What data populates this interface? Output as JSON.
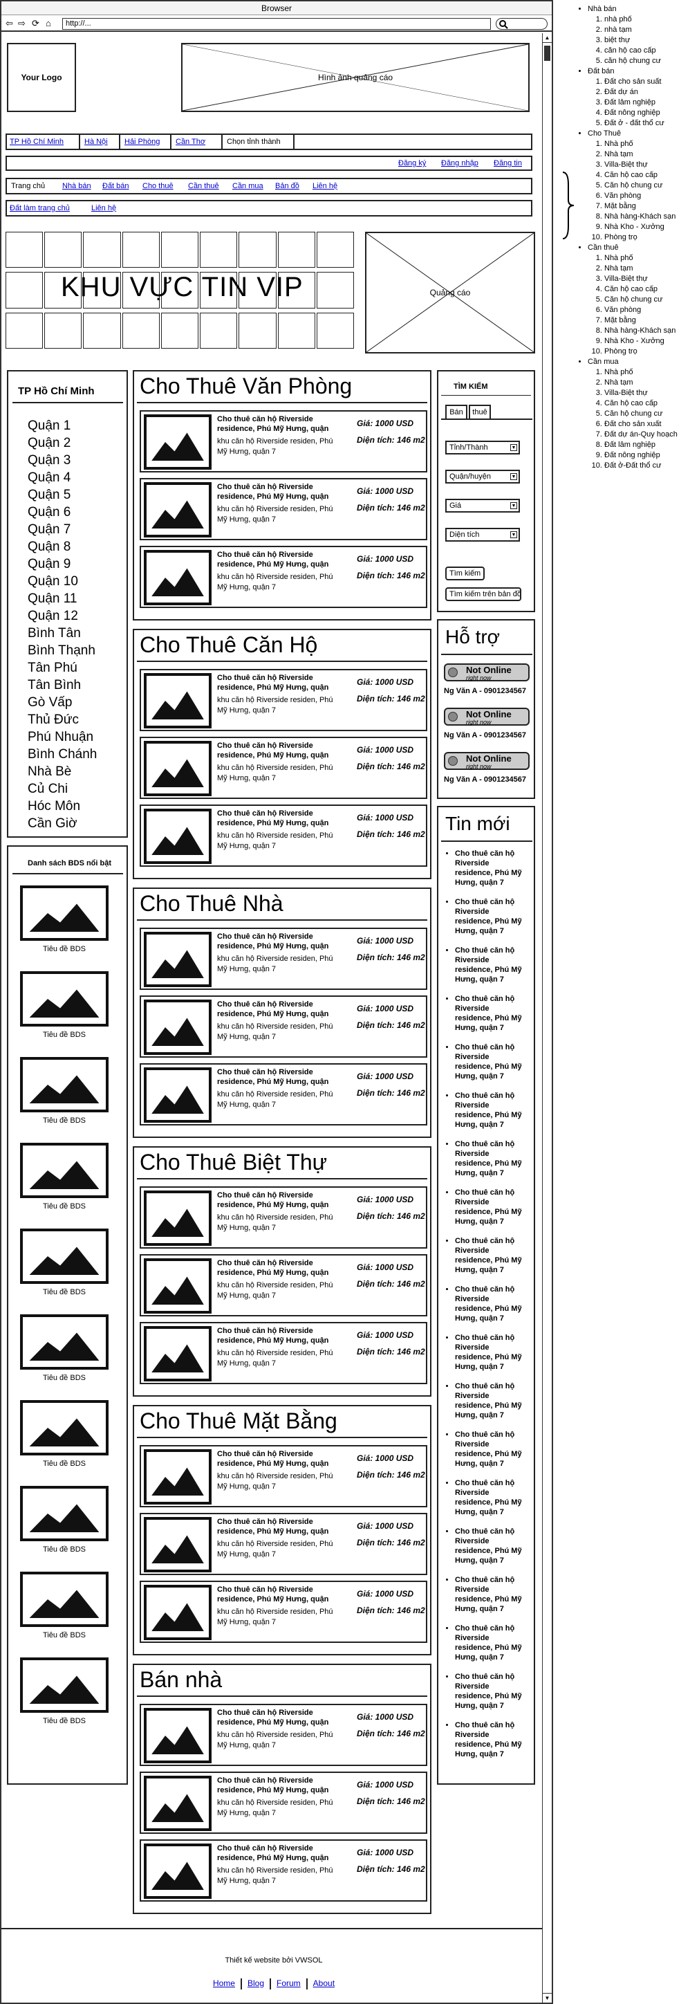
{
  "browser": {
    "title": "Browser",
    "url": "http://...",
    "back": "⇦",
    "forward": "⇨",
    "refresh": "⟳",
    "home": "⌂"
  },
  "header": {
    "logo": "Your Logo",
    "ad_banner": "Hình ảnh quảng cáo"
  },
  "cities": [
    {
      "label": "TP Hồ Chí Minh"
    },
    {
      "label": "Hà Nội"
    },
    {
      "label": "Hải Phòng"
    },
    {
      "label": "Cần Thơ"
    },
    {
      "label": "Chọn tỉnh thành"
    }
  ],
  "account": {
    "register": "Đăng ký",
    "login": "Đăng nhập",
    "post": "Đăng tin"
  },
  "menu": [
    {
      "label": "Trang chủ"
    },
    {
      "label": "Nhà bán"
    },
    {
      "label": "Đất bán"
    },
    {
      "label": "Cho thuê"
    },
    {
      "label": "Cần thuê"
    },
    {
      "label": "Cần mua"
    },
    {
      "label": "Bản đồ"
    },
    {
      "label": "Liên hệ"
    }
  ],
  "menu2": [
    {
      "label": "Đất làm trang chủ"
    },
    {
      "label": "Liên hệ"
    }
  ],
  "vip": {
    "title": "KHU VỰC TIN VIP",
    "ad": "Quảng cáo"
  },
  "left": {
    "city_title": "TP Hồ Chí Minh",
    "districts": [
      "Quận 1",
      "Quận 2",
      "Quận 3",
      "Quận 4",
      "Quận 5",
      "Quận 6",
      "Quận 7",
      "Quận 8",
      "Quận 9",
      "Quận 10",
      "Quận 11",
      "Quận 12",
      "Bình Tân",
      "Bình Thạnh",
      "Tân Phú",
      "Tân Bình",
      "Gò Vấp",
      "Thủ Đức",
      "Phú Nhuận",
      "Bình Chánh",
      "Nhà Bè",
      "Củ Chi",
      "Hóc Môn",
      "Cần Giờ"
    ],
    "featured_title": "Danh sách BDS nổi bật",
    "featured_caption": "Tiêu đề BDS"
  },
  "sections": [
    {
      "title": "Cho Thuê Văn Phòng"
    },
    {
      "title": "Cho Thuê Căn Hộ"
    },
    {
      "title": "Cho Thuê Nhà"
    },
    {
      "title": "Cho Thuê Biệt Thự"
    },
    {
      "title": "Cho Thuê Mặt Bằng"
    },
    {
      "title": "Bán nhà"
    }
  ],
  "listing": {
    "title": "Cho thuê căn hộ Riverside residence, Phú Mỹ Hưng, quận",
    "desc": "khu căn hộ Riverside residen, Phú Mỹ Hưng, quận 7",
    "price": "Giá: 1000 USD",
    "area": "Diện tích: 146 m2"
  },
  "search": {
    "title": "TÌM KIẾM",
    "tab_sell": "Bán",
    "tab_rent": "thuê",
    "province": "Tỉnh/Thành",
    "district": "Quận/huyện",
    "price": "Giá",
    "area": "Diện tích",
    "btn_search": "Tìm kiếm",
    "btn_map": "Tìm kiếm trên bản đồ"
  },
  "support": {
    "title": "Hỗ trợ",
    "status": "Not Online",
    "status_sub": "right now",
    "contact": "Ng Văn A - 0901234567"
  },
  "news": {
    "title": "Tin mới",
    "item": "Cho thuê căn hộ Riverside residence, Phú Mỹ Hưng, quận 7"
  },
  "footer": {
    "credit": "Thiết kế website bởi VWSOL",
    "links": [
      {
        "label": "Home"
      },
      {
        "label": "Blog"
      },
      {
        "label": "Forum"
      },
      {
        "label": "About"
      }
    ]
  },
  "sitemap": [
    {
      "label": "Nhà bán",
      "children": [
        "nhà phố",
        "nhà tạm",
        "biệt thự",
        "căn hộ cao cấp",
        "căn hộ chung cư"
      ]
    },
    {
      "label": "Đất bán",
      "children": [
        "Đất cho sản suất",
        "Đất dự án",
        "Đất lâm nghiệp",
        "Đất nông nghiệp",
        "Đất ở - đất thổ cư"
      ]
    },
    {
      "label": "Cho Thuê",
      "children": [
        "Nhà phố",
        "Nhà tạm",
        "Villa-Biệt thự",
        "Căn hộ cao cấp",
        "Căn hộ chung cư",
        "Văn phòng",
        "Mặt bằng",
        "Nhà hàng-Khách sạn",
        "Nhà Kho - Xưởng",
        "Phòng trọ"
      ]
    },
    {
      "label": "Cần thuê",
      "children": [
        "Nhà phố",
        "Nhà tạm",
        "Villa-Biệt thự",
        "Căn hộ cao cấp",
        "Căn hộ chung cư",
        "Văn phòng",
        "Mặt bằng",
        "Nhà hàng-Khách sạn",
        "Nhà Kho - Xưởng",
        "Phòng trọ"
      ]
    },
    {
      "label": "Cần mua",
      "children": [
        "Nhà phố",
        "Nhà tạm",
        "Villa-Biệt thự",
        "Căn hộ cao cấp",
        "Căn hộ chung cư",
        "Đất cho sản xuất",
        "Đất dự án-Quy hoạch",
        "Đất lâm nghiệp",
        "Đất nông nghiệp",
        "Đất ở-Đất thổ cư"
      ]
    }
  ]
}
